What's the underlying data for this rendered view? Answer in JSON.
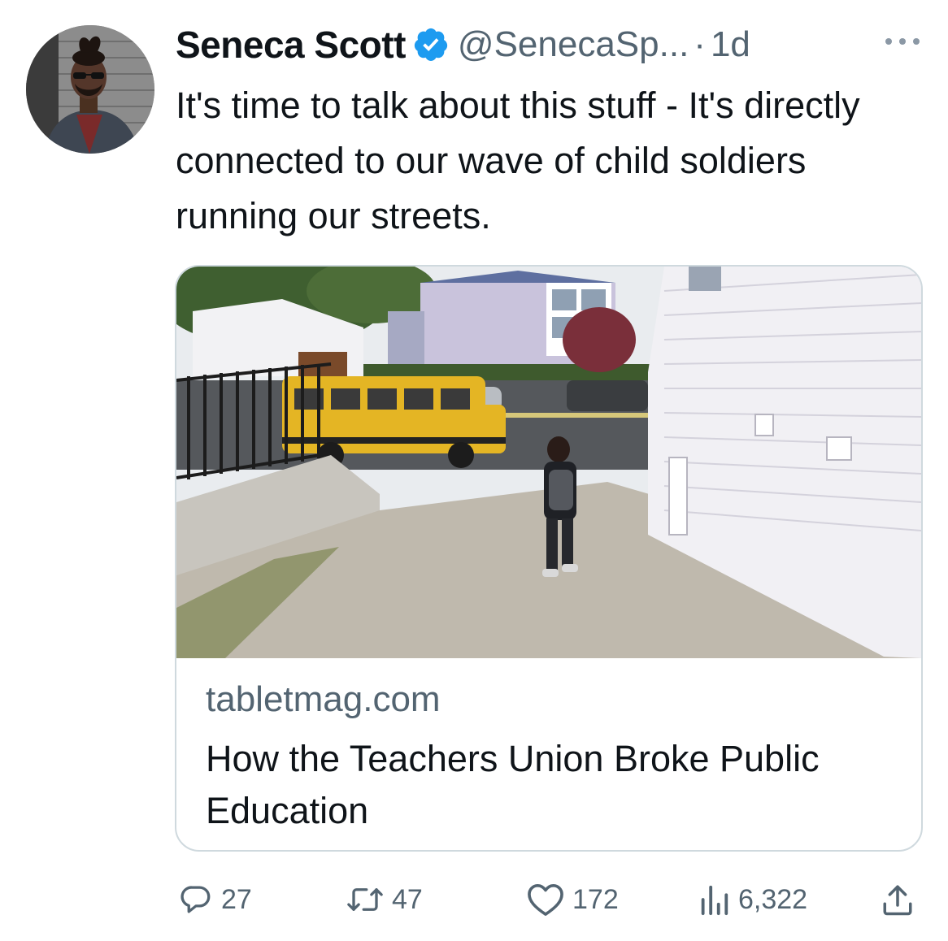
{
  "tweet": {
    "author_name": "Seneca Scott",
    "verified_icon": "verified-badge-icon",
    "handle": "@SenecaSp...",
    "separator": "·",
    "age": "1d",
    "text": "It's time to talk about this stuff - It's directly connected to our wave of child soldiers running our streets."
  },
  "link_card": {
    "domain": "tabletmag.com",
    "title": "How the Teachers Union Broke Public Education"
  },
  "actions": {
    "replies": "27",
    "reposts": "47",
    "likes": "172",
    "views": "6,322"
  },
  "colors": {
    "text": "#0f1419",
    "muted": "#536471",
    "border": "#cfd9de",
    "verified": "#1d9bf0"
  }
}
